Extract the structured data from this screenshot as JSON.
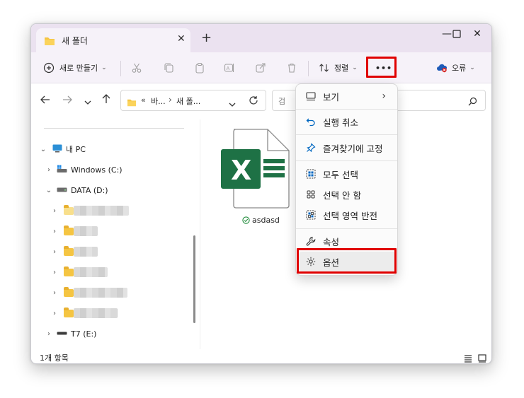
{
  "window": {
    "tab_title": "새 폴더",
    "tab_close": "✕",
    "new_tab": "+",
    "minimize": "—",
    "maximize": "☐",
    "close": "✕"
  },
  "toolbar": {
    "new_label": "새로 만들기",
    "sort_label": "정렬",
    "more_label": "•••",
    "error_label": "오류"
  },
  "address": {
    "overflow": "«",
    "crumb1": "바...",
    "separator": "›",
    "crumb2": "새 폴...",
    "dropdown": "⌄"
  },
  "sidebar": {
    "this_pc": "내 PC",
    "drive_c": "Windows (C:)",
    "drive_d": "DATA (D:)",
    "drive_e": "T7 (E:)",
    "blurred_folders": [
      {
        "w": 74
      },
      {
        "w": 32
      },
      {
        "w": 32
      },
      {
        "w": 48
      },
      {
        "w": 74
      },
      {
        "w": 60
      }
    ]
  },
  "file": {
    "name": "asdasd",
    "letter": "X"
  },
  "status": {
    "count": "1개 항목"
  },
  "menu": {
    "items": [
      {
        "label": "보기",
        "icon": "view-icon",
        "arrow": "›"
      },
      {
        "label": "실행 취소",
        "icon": "undo-icon"
      },
      {
        "label": "즐겨찾기에 고정",
        "icon": "pin-icon"
      },
      {
        "label": "모두 선택",
        "icon": "select-all-icon"
      },
      {
        "label": "선택 안 함",
        "icon": "select-none-icon"
      },
      {
        "label": "선택 영역 반전",
        "icon": "invert-selection-icon"
      },
      {
        "label": "속성",
        "icon": "properties-icon"
      },
      {
        "label": "옵션",
        "icon": "options-icon"
      }
    ]
  },
  "colors": {
    "highlight": "#e00000",
    "excel_green": "#1e7145",
    "folder": "#f5c542",
    "accent": "#0067c0"
  }
}
